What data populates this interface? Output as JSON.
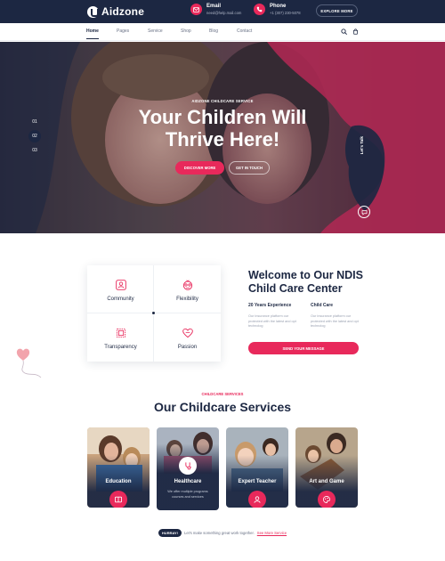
{
  "brand": {
    "name": "Aidzone"
  },
  "topbar": {
    "email_title": "Email",
    "email_value": "need@help.mail.com",
    "phone_title": "Phone",
    "phone_value": "+1 (307) 230-5078",
    "explore_label": "EXPLORE MORE"
  },
  "nav": {
    "items": [
      "Home",
      "Pages",
      "Service",
      "Shop",
      "Blog",
      "Contact"
    ],
    "active": "Home"
  },
  "hero": {
    "tag": "AIDZONE CHILDCARE SERVICE",
    "title_line1": "Your Children Will",
    "title_line2": "Thrive Here!",
    "primary_btn": "DISCOVER MORE",
    "secondary_btn": "GET IN TOUCH",
    "slides": [
      "01",
      "02",
      "03"
    ],
    "active_slide": "02",
    "side_label": "Let's Talk"
  },
  "welcome": {
    "features": [
      "Community",
      "Flexibility",
      "Transparency",
      "Passion"
    ],
    "title_line1": "Welcome to Our NDIS",
    "title_line2": "Child Care Center",
    "col1_title": "20 Years Experience",
    "col1_text": "Our insurance platform our protected with the latest and opt technolog",
    "col2_title": "Child Care",
    "col2_text": "Our insurance platform our protected with the latest and opt technolog",
    "button": "SEND YOUR MESSAGE"
  },
  "services": {
    "tag": "CHILDCARE SERVICES",
    "title": "Our Childcare Services",
    "cards": [
      {
        "label": "Education"
      },
      {
        "label": "Healthcare",
        "desc": "We offer multiple programs courses and services"
      },
      {
        "label": "Expert Teacher"
      },
      {
        "label": "Art and Game"
      }
    ]
  },
  "footer": {
    "badge": "HURRAY!",
    "text": "Let's make something great work together.",
    "link": "See More Service"
  },
  "colors": {
    "navy": "#1c2742",
    "accent": "#e8295b",
    "white": "#ffffff"
  }
}
